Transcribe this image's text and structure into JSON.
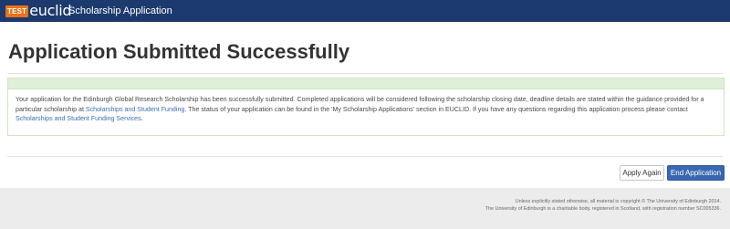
{
  "header": {
    "logo_badge": "TEST",
    "logo_text": "euclid",
    "app_title": "Scholarship Application"
  },
  "main": {
    "title": "Application Submitted Successfully",
    "message": {
      "text_1": "Your application for the Edinburgh Global Research Scholarship has been successfully submitted. Completed applications will be considered following the scholarship closing date, deadline details are stated within the guidance provided for a particular scholarship at ",
      "link_1": "Scholarships and Student Funding",
      "text_2": ". The status of your application can be found in the 'My Scholarship Applications' section in EUCLID. If you have any questions regarding this application process please contact ",
      "link_2": "Scholarships and Student Funding Services",
      "text_3": "."
    }
  },
  "actions": {
    "apply_again": "Apply Again",
    "end_application": "End Application"
  },
  "footer": {
    "line_1": "Unless explicitly stated otherwise, all material is copyright © The University of Edinburgh 2014.",
    "line_2": "The University of Edinburgh is a charitable body, registered in Scotland, with registration number SC005336."
  },
  "colors": {
    "header_bg": "#1d3a6e",
    "success_bg": "#dff0d8",
    "primary_button": "#3a67b1",
    "link": "#3a6db0",
    "footer_bg": "#ececec"
  }
}
